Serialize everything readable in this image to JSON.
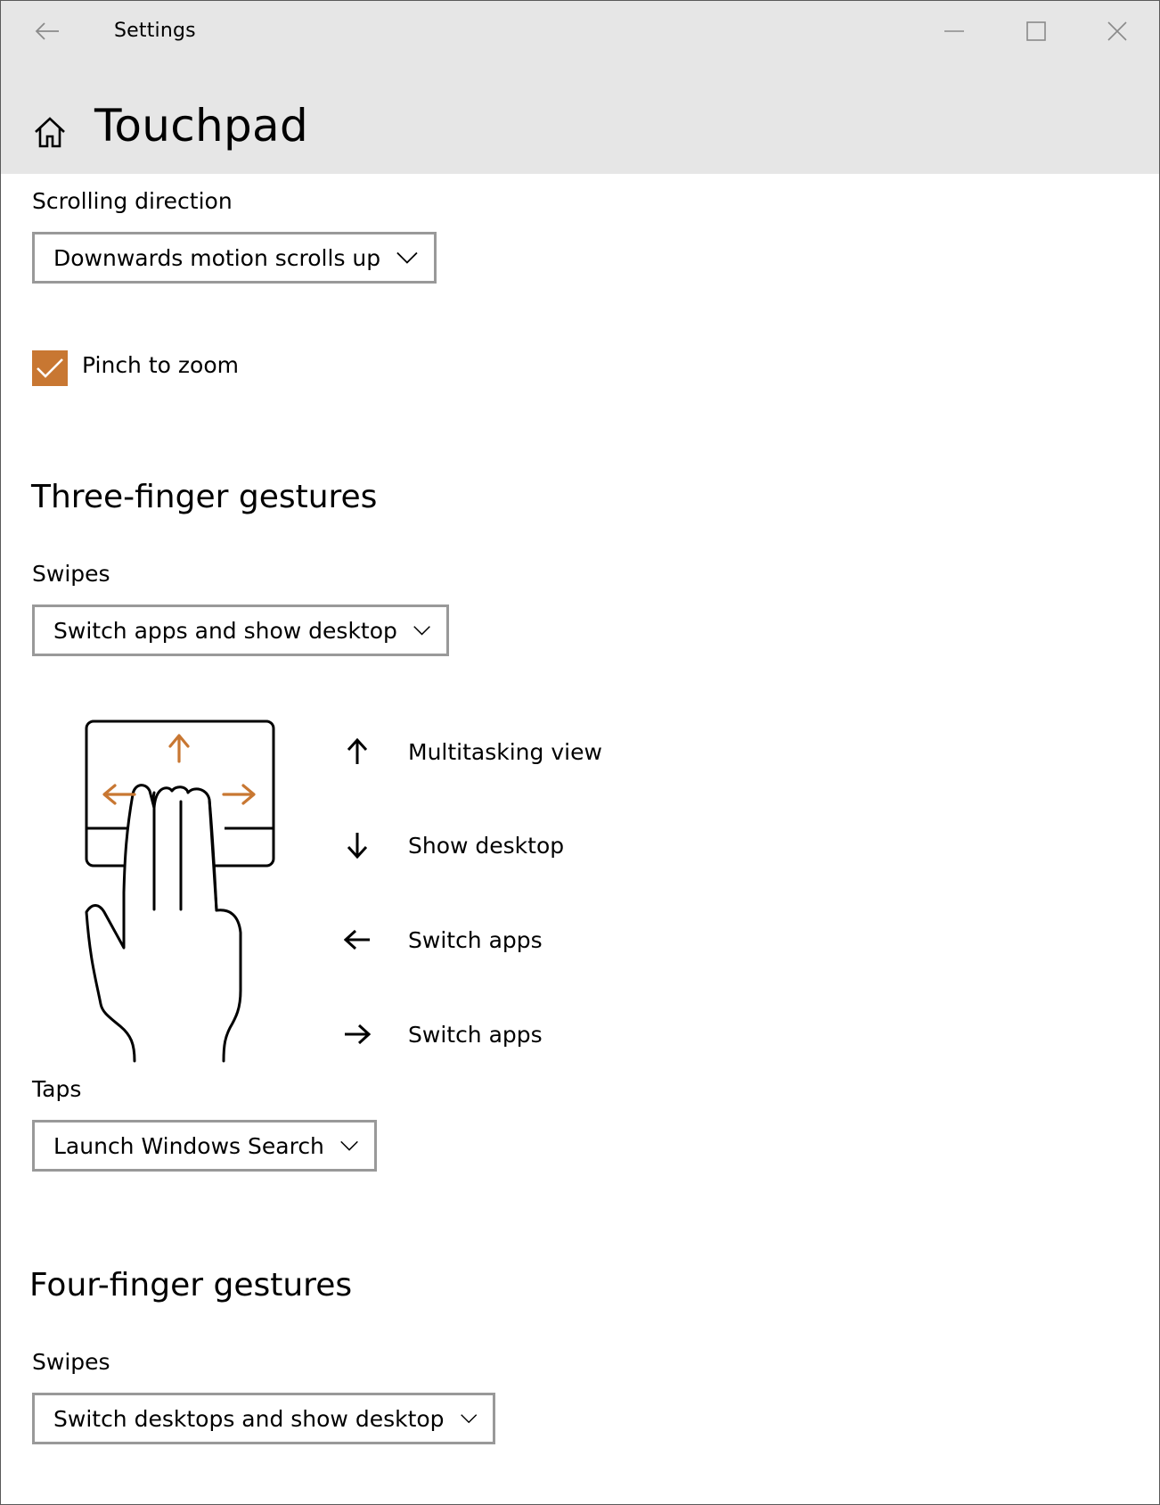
{
  "window": {
    "app_title": "Settings",
    "page_title": "Touchpad",
    "accent_color": "#c87732"
  },
  "scrolling": {
    "label": "Scrolling direction",
    "selected": "Downwards motion scrolls up"
  },
  "pinch": {
    "label": "Pinch to zoom",
    "checked": true
  },
  "three_finger": {
    "heading": "Three-finger gestures",
    "swipes_label": "Swipes",
    "swipes_selected": "Switch apps and show desktop",
    "gestures": [
      {
        "icon": "arrow-up-icon",
        "label": "Multitasking view"
      },
      {
        "icon": "arrow-down-icon",
        "label": "Show desktop"
      },
      {
        "icon": "arrow-left-icon",
        "label": "Switch apps"
      },
      {
        "icon": "arrow-right-icon",
        "label": "Switch apps"
      }
    ],
    "taps_label": "Taps",
    "taps_selected": "Launch Windows Search"
  },
  "four_finger": {
    "heading": "Four-finger gestures",
    "swipes_label": "Swipes",
    "swipes_selected": "Switch desktops and show desktop"
  }
}
